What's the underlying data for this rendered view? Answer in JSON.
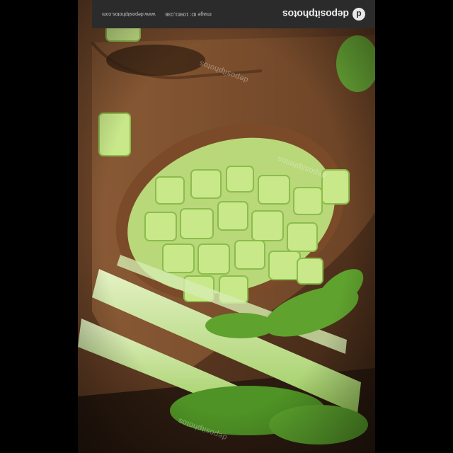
{
  "image": {
    "subject": "diced celery",
    "orientation": "upside-down"
  },
  "banner": {
    "brand": "depositphotos",
    "brand_icon": "depositphotos-logo-icon",
    "image_id": "Image ID: 10961,038",
    "site": "www.depositphotos.com",
    "background": "#2b2b2b"
  },
  "watermark": {
    "text": "depositphotos"
  },
  "colors": {
    "wood": "#6b4328",
    "celery": "#b9e07a",
    "background": "#000000"
  }
}
